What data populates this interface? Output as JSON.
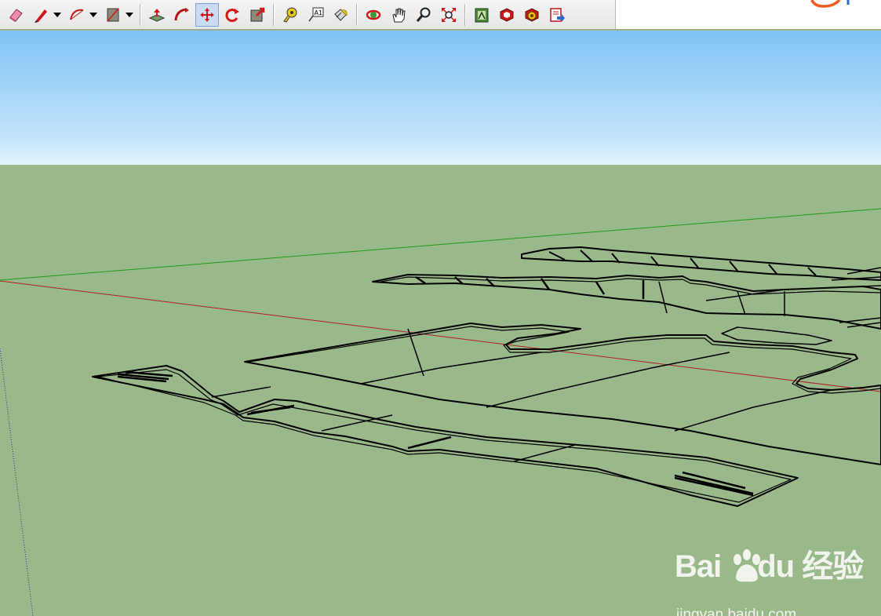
{
  "toolbar": {
    "tools": [
      {
        "icon": "eraser-icon",
        "has_dropdown": false
      },
      {
        "icon": "pencil-icon",
        "has_dropdown": true
      },
      {
        "icon": "arc-icon",
        "has_dropdown": true
      },
      {
        "icon": "rectangle-icon",
        "has_dropdown": true
      },
      {
        "icon": "push-pull-icon",
        "has_dropdown": false
      },
      {
        "icon": "follow-me-icon",
        "has_dropdown": false
      },
      {
        "icon": "move-icon",
        "has_dropdown": false,
        "active": true
      },
      {
        "icon": "rotate-icon",
        "has_dropdown": false
      },
      {
        "icon": "scale-icon",
        "has_dropdown": false
      },
      {
        "icon": "tape-measure-icon",
        "has_dropdown": false
      },
      {
        "icon": "text-icon",
        "has_dropdown": false,
        "label": "A1"
      },
      {
        "icon": "paint-bucket-icon",
        "has_dropdown": false
      },
      {
        "icon": "orbit-icon",
        "has_dropdown": false
      },
      {
        "icon": "pan-icon",
        "has_dropdown": false
      },
      {
        "icon": "zoom-icon",
        "has_dropdown": false
      },
      {
        "icon": "zoom-extents-icon",
        "has_dropdown": false
      },
      {
        "icon": "3d-warehouse-icon",
        "has_dropdown": false
      },
      {
        "icon": "components-icon",
        "has_dropdown": false
      },
      {
        "icon": "extension-warehouse-icon",
        "has_dropdown": false
      },
      {
        "icon": "send-to-layout-icon",
        "has_dropdown": false
      }
    ]
  },
  "colors": {
    "sky_top": "#7fc3f6",
    "sky_horizon": "#e2f3fc",
    "ground": "#9ab98b",
    "green_axis": "#1f9a1f",
    "red_axis": "#b02020",
    "blue_axis": "#2a2a9a",
    "edges": "#000000",
    "active_tool": "#c9dcf2"
  },
  "watermark": {
    "logo_text": "Bai",
    "logo_text_2": "du",
    "logo_cn": "经验",
    "url": "jingyan.baidu.com"
  }
}
